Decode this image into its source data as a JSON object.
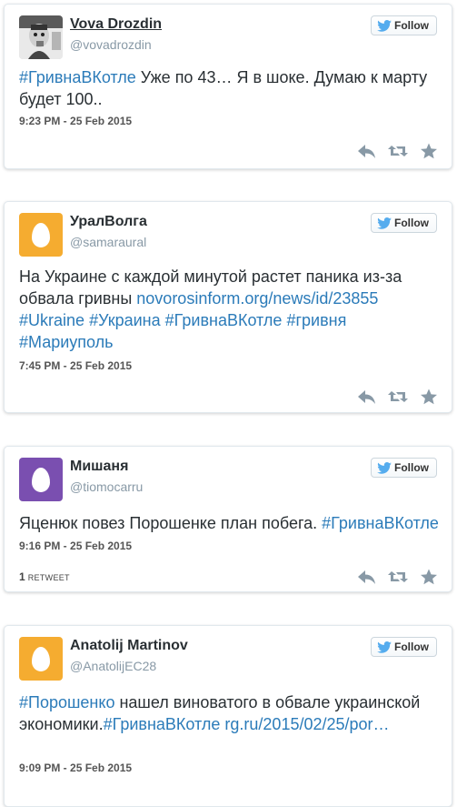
{
  "tweets": [
    {
      "name": "Vova Drozdin",
      "handle": "@vovadrozdin",
      "follow_label": "Follow",
      "text_parts": [
        {
          "t": "#ГривнаВКотле",
          "kind": "hashtag"
        },
        {
          "t": " Уже по 43… Я в шоке. Думаю к марту будет 100..",
          "kind": "text"
        }
      ],
      "date": "9:23 PM - 25 Feb 2015",
      "avatar": "photo"
    },
    {
      "name": "УралВолга",
      "handle": "@samaraural",
      "follow_label": "Follow",
      "text_parts": [
        {
          "t": "На Украине с каждой минутой растет паника из-за обвала гривны ",
          "kind": "text"
        },
        {
          "t": "novorosinform.org/news/id/23855",
          "kind": "link"
        },
        {
          "t": " ",
          "kind": "text"
        },
        {
          "t": "#Ukraine",
          "kind": "hashtag"
        },
        {
          "t": " ",
          "kind": "text"
        },
        {
          "t": "#Украина",
          "kind": "hashtag"
        },
        {
          "t": " ",
          "kind": "text"
        },
        {
          "t": "#ГривнаВКотле",
          "kind": "hashtag"
        },
        {
          "t": " ",
          "kind": "text"
        },
        {
          "t": "#гривня",
          "kind": "hashtag"
        },
        {
          "t": " ",
          "kind": "text"
        },
        {
          "t": "#Мариуполь",
          "kind": "hashtag"
        }
      ],
      "date": "7:45 PM - 25 Feb 2015",
      "avatar": "egg",
      "avatar_color": "#f5ac30"
    },
    {
      "name": "Мишаня",
      "handle": "@tiomocarru",
      "follow_label": "Follow",
      "text_parts": [
        {
          "t": "Яценюк повез Порошенке план побега. ",
          "kind": "text"
        },
        {
          "t": "#ГривнаВКотле",
          "kind": "hashtag"
        }
      ],
      "date": "9:16 PM - 25 Feb 2015",
      "retweet_count": "1",
      "retweet_label": "RETWEET",
      "avatar": "egg",
      "avatar_color": "#7a4fb0"
    },
    {
      "name": "Anatolij Martinov",
      "handle": "@AnatolijEC28",
      "follow_label": "Follow",
      "text_parts": [
        {
          "t": "#Порошенко",
          "kind": "hashtag"
        },
        {
          "t": " нашел виноватого в обвале украинской экономики.",
          "kind": "text"
        },
        {
          "t": "#ГривнаВКотле",
          "kind": "hashtag"
        },
        {
          "t": " ",
          "kind": "text"
        },
        {
          "t": "rg.ru/2015/02/25/por…",
          "kind": "link"
        }
      ],
      "date": "9:09 PM - 25 Feb 2015",
      "avatar": "egg",
      "avatar_color": "#f5ac30"
    }
  ],
  "colors": {
    "link": "#2b7bb9",
    "twitter_blue": "#55acee",
    "icon_gray": "#8899a6"
  },
  "icons": [
    "twitter-bird-icon",
    "reply-icon",
    "retweet-icon",
    "favorite-icon"
  ]
}
